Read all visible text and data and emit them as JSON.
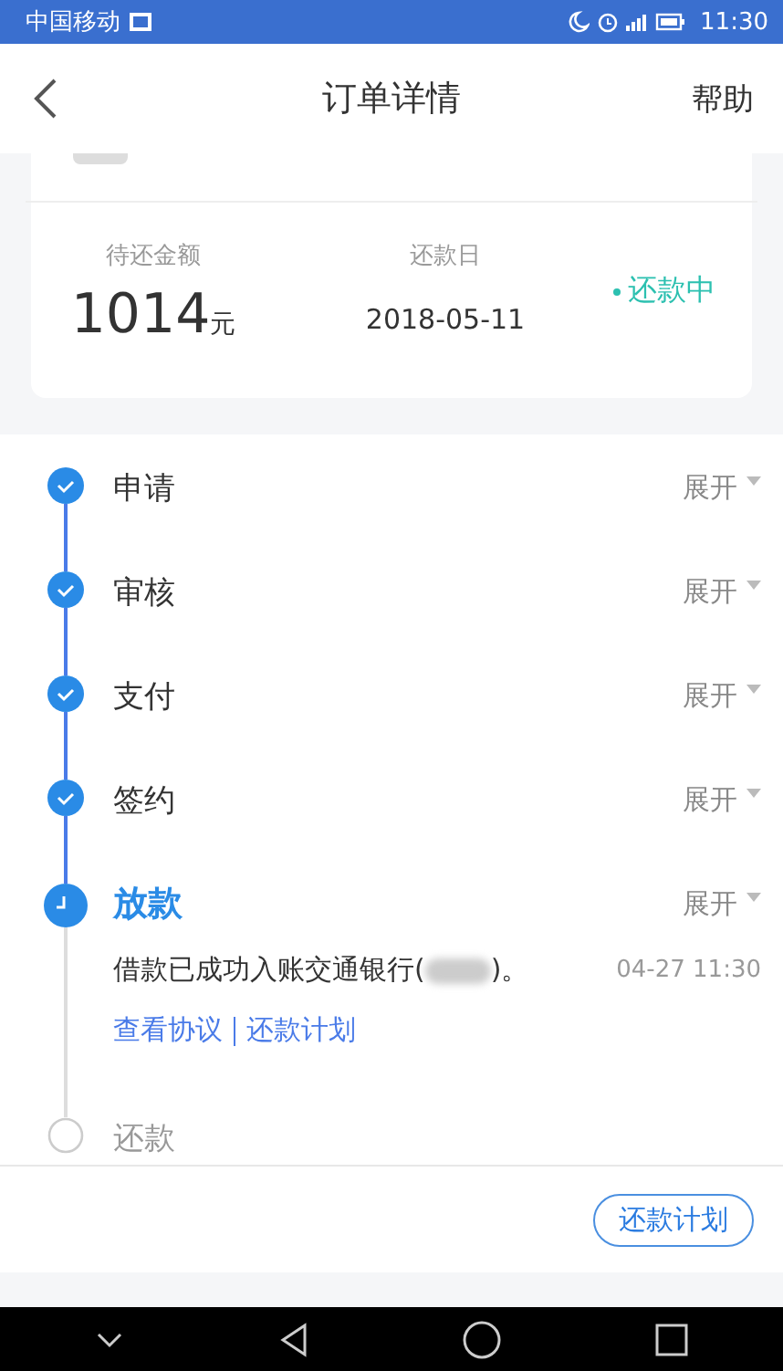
{
  "status_bar": {
    "carrier": "中国移动",
    "time": "11:30"
  },
  "nav": {
    "title": "订单详情",
    "help": "帮助"
  },
  "summary": {
    "amount_label": "待还金额",
    "amount": "1014",
    "unit": "元",
    "date_label": "还款日",
    "date": "2018-05-11",
    "status": "还款中"
  },
  "steps": [
    {
      "label": "申请",
      "kind": "done",
      "expand": "展开"
    },
    {
      "label": "审核",
      "kind": "done",
      "expand": "展开"
    },
    {
      "label": "支付",
      "kind": "done",
      "expand": "展开"
    },
    {
      "label": "签约",
      "kind": "done",
      "expand": "展开"
    },
    {
      "label": "放款",
      "kind": "current",
      "expand": "展开",
      "detail": {
        "message": "借款已成功入账交通银行(",
        "message_end": ")。",
        "time": "04-27 11:30",
        "links": [
          "查看协议",
          "还款计划"
        ]
      }
    },
    {
      "label": "还款",
      "kind": "pending"
    }
  ],
  "footer_button": "还款计划"
}
